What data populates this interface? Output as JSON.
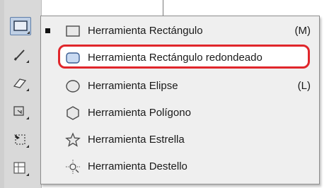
{
  "toolbar": {
    "tools": [
      {
        "name": "rectangle-tool",
        "icon": "rectangle-icon",
        "active": true
      },
      {
        "name": "pencil-tool",
        "icon": "pencil-icon",
        "active": false
      },
      {
        "name": "eraser-tool",
        "icon": "eraser-icon",
        "active": false
      },
      {
        "name": "rotate-tool",
        "icon": "rotate-icon",
        "active": false
      },
      {
        "name": "free-transform-tool",
        "icon": "free-transform-icon",
        "active": false
      },
      {
        "name": "symbol-sprayer-tool",
        "icon": "symbol-sprayer-icon",
        "active": false
      }
    ]
  },
  "menu": {
    "items": [
      {
        "label": "Herramienta Rectángulo",
        "shortcut": "(M)",
        "icon": "rectangle-icon",
        "checked": true,
        "highlighted": false
      },
      {
        "label": "Herramienta Rectángulo redondeado",
        "shortcut": "",
        "icon": "rounded-rectangle-icon",
        "checked": false,
        "highlighted": true
      },
      {
        "label": "Herramienta Elipse",
        "shortcut": "(L)",
        "icon": "ellipse-icon",
        "checked": false,
        "highlighted": false
      },
      {
        "label": "Herramienta Polígono",
        "shortcut": "",
        "icon": "polygon-icon",
        "checked": false,
        "highlighted": false
      },
      {
        "label": "Herramienta Estrella",
        "shortcut": "",
        "icon": "star-icon",
        "checked": false,
        "highlighted": false
      },
      {
        "label": "Herramienta Destello",
        "shortcut": "",
        "icon": "flare-icon",
        "checked": false,
        "highlighted": false
      }
    ]
  },
  "colors": {
    "highlight_ring": "#e0262b",
    "active_tool_bg": "#bfcfe4",
    "menu_bg": "#efefef"
  }
}
